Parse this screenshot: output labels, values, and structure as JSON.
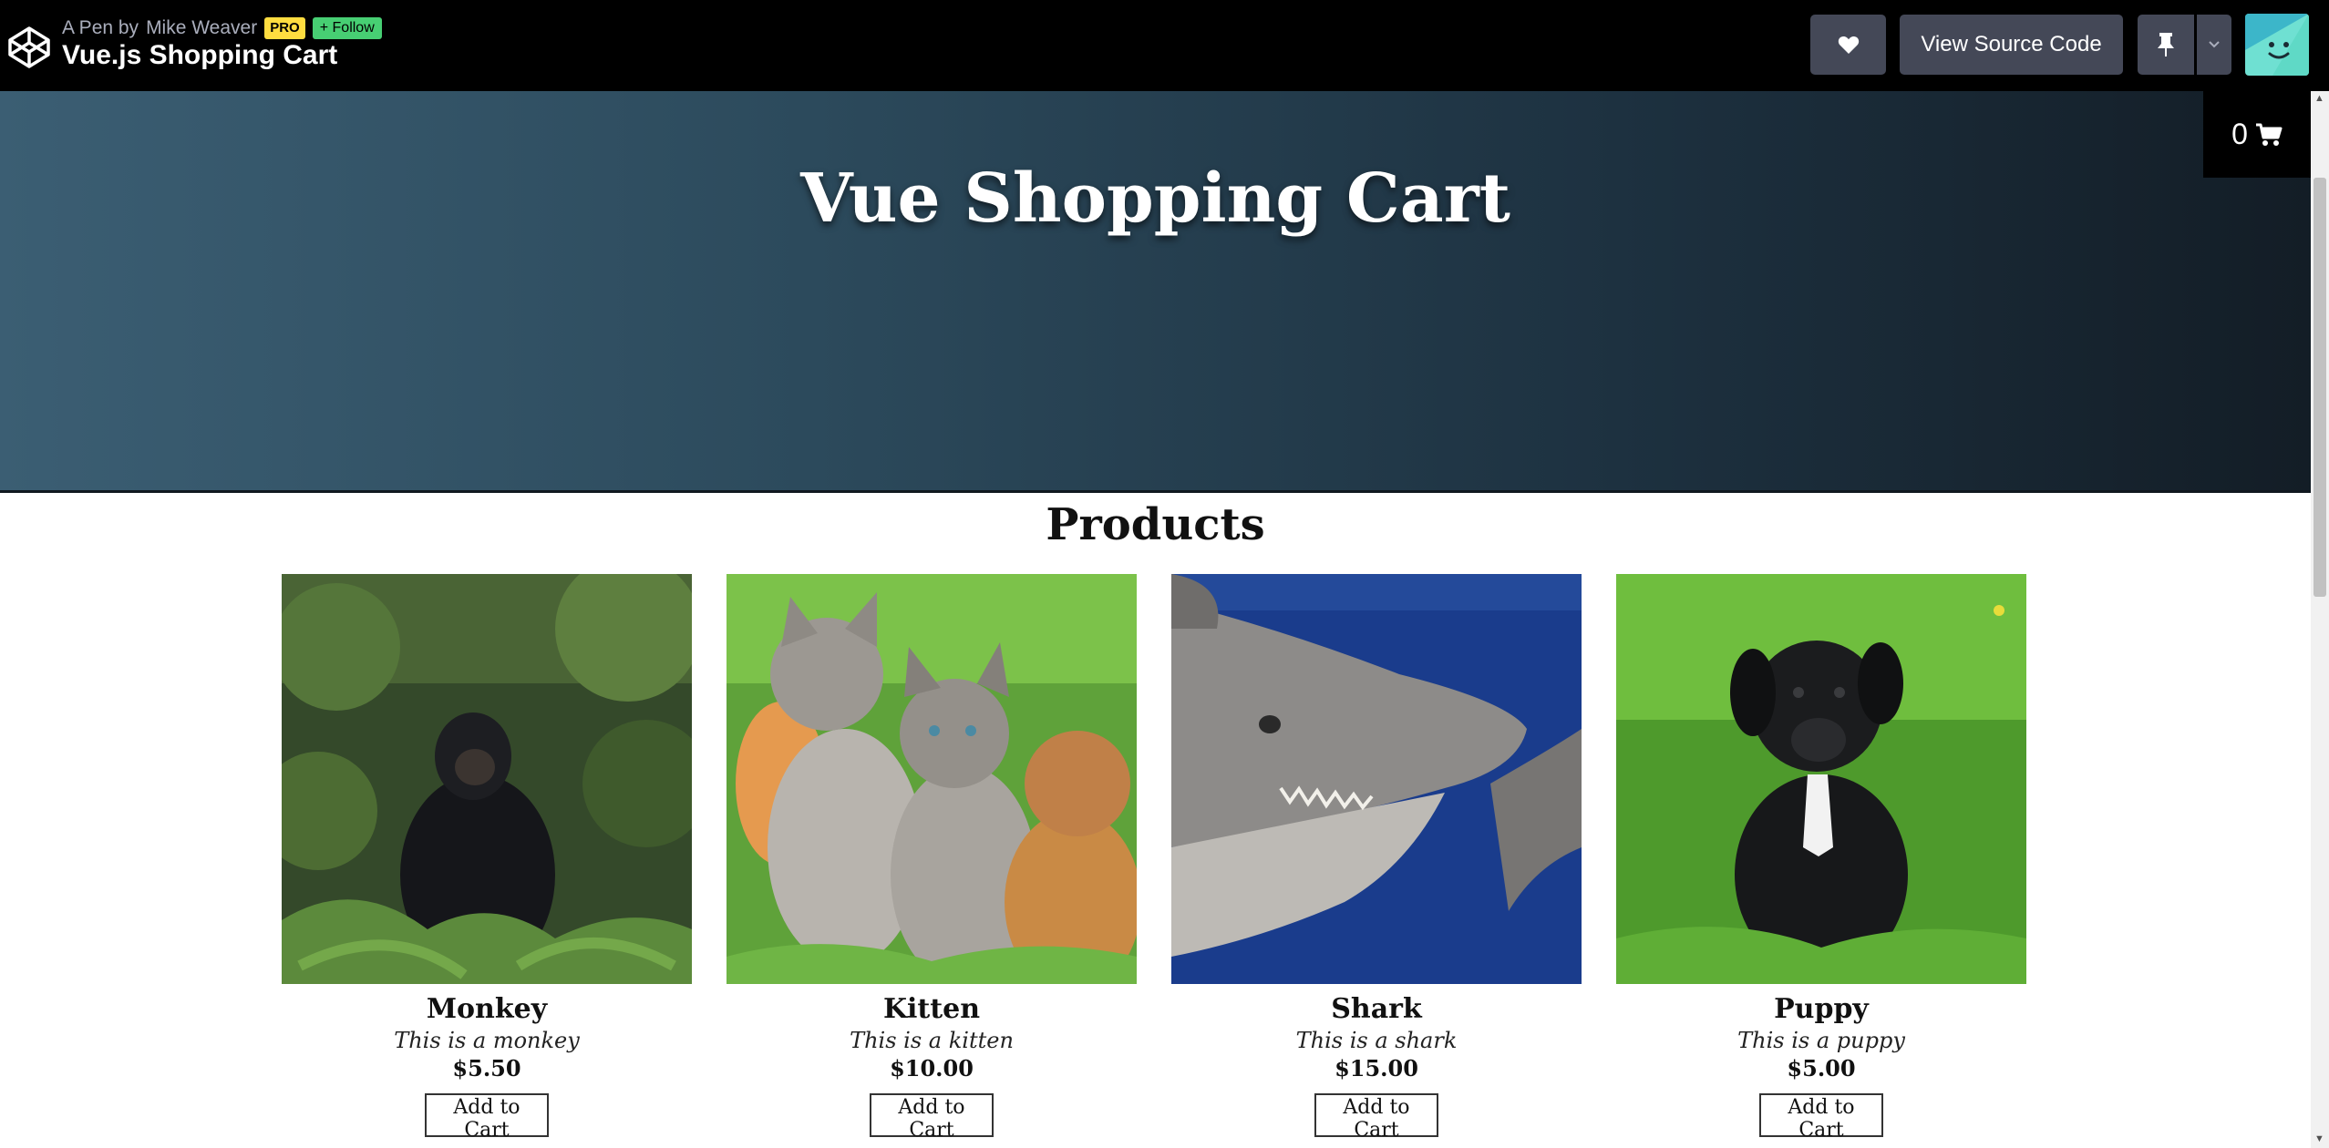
{
  "topbar": {
    "pen_prefix": "A Pen by",
    "author": "Mike Weaver",
    "pro_badge": "PRO",
    "follow_label": "+ Follow",
    "pen_title": "Vue.js Shopping Cart",
    "heart_icon": "heart-icon",
    "view_source_label": "View Source Code",
    "pin_icon": "pin-icon",
    "caret_icon": "chevron-down-icon"
  },
  "hero": {
    "title": "Vue Shopping Cart"
  },
  "cart": {
    "count": "0",
    "icon": "shopping-cart-icon"
  },
  "products": {
    "heading": "Products",
    "items": [
      {
        "name": "Monkey",
        "description": "This is a monkey",
        "price": "$5.50",
        "button": "Add to Cart"
      },
      {
        "name": "Kitten",
        "description": "This is a kitten",
        "price": "$10.00",
        "button": "Add to Cart"
      },
      {
        "name": "Shark",
        "description": "This is a shark",
        "price": "$15.00",
        "button": "Add to Cart"
      },
      {
        "name": "Puppy",
        "description": "This is a puppy",
        "price": "$5.00",
        "button": "Add to Cart"
      }
    ]
  },
  "colors": {
    "topbar_bg": "#000000",
    "button_bg": "#444857",
    "pro_badge": "#ffdd40",
    "follow_badge": "#47cf73",
    "hero_left": "#3b5e73",
    "hero_right": "#131d26"
  }
}
